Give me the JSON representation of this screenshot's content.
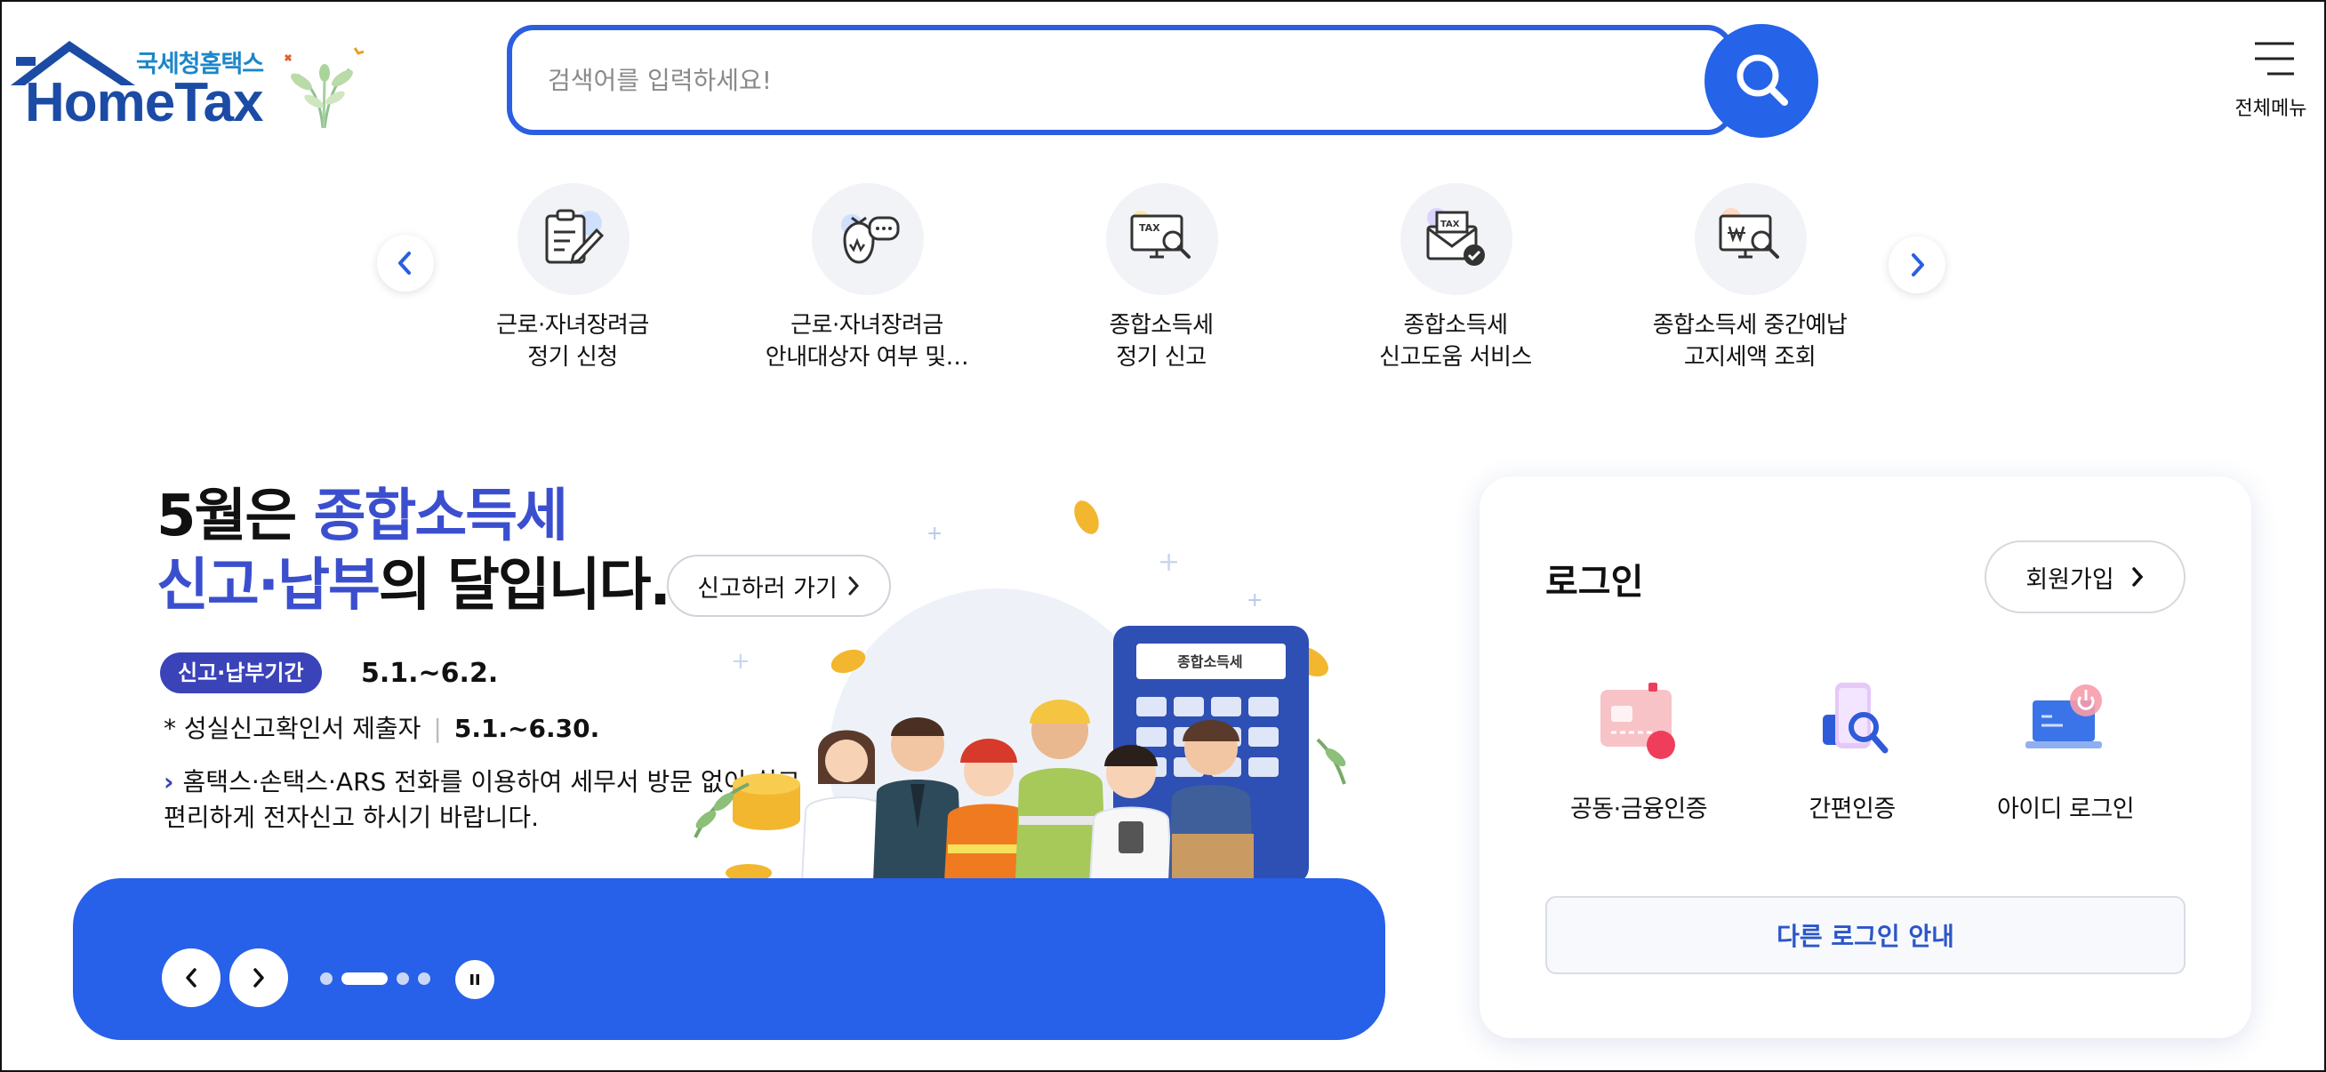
{
  "brand": {
    "tagline": "국세청홈택스",
    "wordmark": "HomeTax"
  },
  "search": {
    "placeholder": "검색어를 입력하세요!",
    "button_icon": "search-icon"
  },
  "menu": {
    "label": "전체메뉴",
    "icon": "hamburger-icon"
  },
  "quick_services": {
    "prev_icon": "chevron-left-icon",
    "next_icon": "chevron-right-icon",
    "items": [
      {
        "line1": "근로·자녀장려금",
        "line2": "정기 신청",
        "icon": "clipboard-pen-icon"
      },
      {
        "line1": "근로·자녀장려금",
        "line2": "안내대상자 여부 및…",
        "icon": "moneybag-chat-icon"
      },
      {
        "line1": "종합소득세",
        "line2": "정기 신고",
        "icon": "tax-monitor-search-icon"
      },
      {
        "line1": "종합소득세",
        "line2": "신고도움 서비스",
        "icon": "tax-envelope-check-icon"
      },
      {
        "line1": "종합소득세 중간예납",
        "line2": "고지세액 조회",
        "icon": "won-monitor-search-icon"
      }
    ]
  },
  "hero": {
    "title_line1_pre": "5월은 ",
    "title_line1_hl": "종합소득세",
    "title_line2_hl": "신고·납부",
    "title_line2_post": "의 달입니다.",
    "cta_label": "신고하러 가기",
    "badge": "신고·납부기간",
    "period": "5.1.~6.2.",
    "sub_label": "* 성실신고확인서 제출자",
    "sub_period": "5.1.~6.30.",
    "note": "홈택스·손택스·ARS 전화를 이용하여 세무서 방문 없이 쉽고 편리하게 전자신고 하시기 바랍니다.",
    "calculator_label": "종합소득세",
    "slides_total": 4,
    "slide_active": 2,
    "accent": "#2760e9"
  },
  "login": {
    "title": "로그인",
    "signup_label": "회원가입",
    "methods": [
      {
        "label": "공동·금융인증",
        "icon": "certificate-card-icon"
      },
      {
        "label": "간편인증",
        "icon": "phone-search-icon"
      },
      {
        "label": "아이디 로그인",
        "icon": "laptop-power-icon"
      }
    ],
    "other_label": "다른 로그인 안내"
  }
}
